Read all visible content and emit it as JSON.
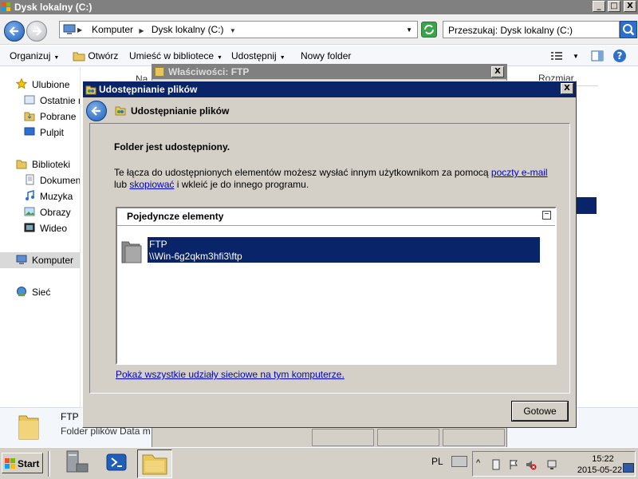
{
  "explorer": {
    "title": "Dysk lokalny (C:)",
    "window_controls": [
      "_",
      "□",
      "X"
    ],
    "address": {
      "crumbs": [
        "Komputer",
        "Dysk lokalny (C:)"
      ],
      "search_placeholder": "Przeszukaj: Dysk lokalny (C:)"
    },
    "toolbar": {
      "organize": "Organizuj",
      "open": "Otwórz",
      "library": "Umieść w bibliotece",
      "share": "Udostępnij",
      "new_folder": "Nowy folder"
    },
    "nav": {
      "favorites": "Ulubione",
      "recent": "Ostatnie m",
      "downloads": "Pobrane",
      "desktop": "Pulpit",
      "libraries": "Biblioteki",
      "documents": "Dokumenty",
      "music": "Muzyka",
      "pictures": "Obrazy",
      "video": "Wideo",
      "computer": "Komputer",
      "network": "Sieć"
    },
    "columns": {
      "name_partial": "Na",
      "size": "Rozmiar"
    },
    "details": {
      "name": "FTP",
      "type": "Folder plików Data mod"
    }
  },
  "properties_window": {
    "title": "Właściwości: FTP"
  },
  "share_dialog": {
    "title": "Udostępnianie plików",
    "header_title": "Udostępnianie plików",
    "heading": "Folder jest udostępniony.",
    "desc_part1": "Te łącza do udostępnionych elementów możesz wysłać innym użytkownikom za pomocą ",
    "desc_link1": "poczty e-mail",
    "desc_part2": "lub ",
    "desc_link2": "skopiować",
    "desc_part3": " i wkleić je do innego programu.",
    "list_header": "Pojedyncze elementy",
    "collapse_symbol": "−",
    "item_name": "FTP",
    "item_path": "\\\\Win-6g2qkm3hfi3\\ftp",
    "show_all_link": "Pokaż wszystkie udziały sieciowe na tym komputerze.",
    "done_button": "Gotowe",
    "close": "X"
  },
  "taskbar": {
    "start": "Start",
    "language": "PL",
    "time": "15:22",
    "date": "2015-05-22"
  },
  "colors": {
    "selection": "#0a246a",
    "link": "#0000cc",
    "dialog_bg": "#d4d0c8"
  }
}
